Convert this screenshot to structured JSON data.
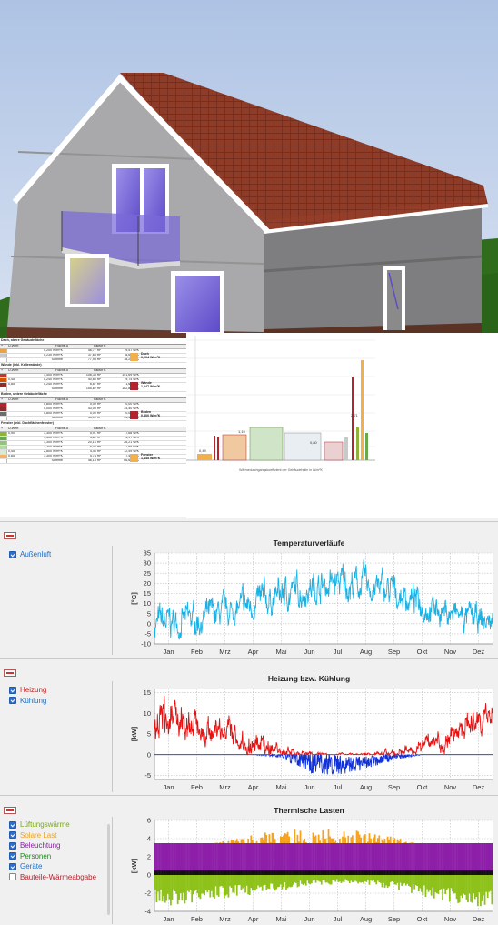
{
  "scene": {
    "colors": {
      "sky_top": "#b7c9e6",
      "sky_bottom": "#e9eef6",
      "grass": "#2d6b1c",
      "roof": "#8c3a28",
      "wall": "#a8a8a8",
      "wall_dark": "#7d7d7d",
      "glass": "#7e6fd6"
    }
  },
  "report": {
    "blocks": [
      {
        "title": "Dach, obere Gebäudefläche",
        "columns": [
          "+",
          "U-Wert",
          "Fläche A",
          "Faktor K"
        ],
        "rows": [
          {
            "color": "#e8a34a",
            "cells": [
              "",
              "0,200 W/m²K",
              "46,77 m²",
              "9,57 W/K"
            ]
          },
          {
            "color": "#c9c9c9",
            "cells": [
              "",
              "0,230 W/m²K",
              "37,68 m²",
              "8,64 W/K"
            ]
          },
          {
            "color": "#ffffff",
            "cells": [
              "",
              "Summe",
              "77,98 m²",
              "18,21 W/K"
            ]
          }
        ],
        "summary": {
          "label": "Dach",
          "value": "0,204 W/m²K",
          "color": "#f2b04b"
        }
      },
      {
        "title": "Wände (inkl. Kellerwände)",
        "columns": [
          "+",
          "U-Wert",
          "Fläche A",
          "Faktor K"
        ],
        "rows": [
          {
            "color": "#c0392b",
            "cells": [
              "",
              "1,400 W/m²K",
              "108,35 m²",
              "151,69 W/K"
            ]
          },
          {
            "color": "#d35400",
            "cells": [
              "0,45",
              "0,240 W/m²K",
              "40,60 m²",
              "9,74 W/K"
            ]
          },
          {
            "color": "#8e2b2b",
            "cells": [
              "0,85",
              "0,240 W/m²K",
              "6,67 m²",
              "1,60 W/K"
            ]
          },
          {
            "color": "#ffffff",
            "cells": [
              "",
              "Summe",
              "155,62 m²",
              "162,84 W/K"
            ]
          }
        ],
        "summary": {
          "label": "Wände",
          "value": "1,047 W/m²K",
          "color": "#b3242e"
        }
      },
      {
        "title": "Boden, untere Gebäudefläche",
        "columns": [
          "+",
          "U-Wert",
          "Fläche A",
          "Faktor K"
        ],
        "rows": [
          {
            "color": "#b3242e",
            "cells": [
              "",
              "0,800 W/m²K",
              "0,00 m²",
              "0,00 W/K"
            ]
          },
          {
            "color": "#8e2b2b",
            "cells": [
              "",
              "0,000 W/m²K",
              "43,00 m²",
              "34,40 W/K"
            ]
          },
          {
            "color": "#6d6d6d",
            "cells": [
              "",
              "0,800 W/m²K",
              "0,00 m²",
              "0,00 W/K"
            ]
          },
          {
            "color": "#ffffff",
            "cells": [
              "",
              "Summe",
              "43,00 m²",
              "34,40 W/K"
            ]
          }
        ],
        "summary": {
          "label": "Boden",
          "value": "0,800 W/m²K",
          "color": "#b3242e"
        }
      },
      {
        "title": "Fenster (inkl. Dachflächenfenster)",
        "columns": [
          "+",
          "U-Wert",
          "Fläche A",
          "Faktor K"
        ],
        "rows": [
          {
            "color": "#8fb33a",
            "cells": [
              "0,90",
              "1,300 W/m²K",
              "5,91 m²",
              "7,68 W/K"
            ]
          },
          {
            "color": "#6aa84f",
            "cells": [
              "",
              "1,300 W/m²K",
              "3,82 m²",
              "4,97 W/K"
            ]
          },
          {
            "color": "#93c47d",
            "cells": [
              "",
              "1,300 W/m²K",
              "20,16 m²",
              "26,21 W/K"
            ]
          },
          {
            "color": "#b6d7a8",
            "cells": [
              "",
              "1,300 W/m²K",
              "6,06 m²",
              "7,88 W/K"
            ]
          },
          {
            "color": "#d9ead3",
            "cells": [
              "0,45",
              "2,800 W/m²K",
              "4,46 m²",
              "12,49 W/K"
            ]
          },
          {
            "color": "#f6b26b",
            "cells": [
              "0,85",
              "1,300 W/m²K",
              "5,74 m²",
              "7,46 W/K"
            ]
          },
          {
            "color": "#ffffff",
            "cells": [
              "",
              "Summe",
              "46,15 m²",
              "66,69 W/K"
            ]
          }
        ],
        "summary": {
          "label": "Fenster",
          "value": "1,445 W/m²K",
          "color": "#f2b04b"
        }
      }
    ],
    "chart": {
      "caption": "Wärmedurchgangskoeffizient der Gebäudehülle in W/m²K",
      "value_labels": [
        "0,49",
        "1,15",
        "0,80",
        "2,71"
      ]
    }
  },
  "panels": [
    {
      "title": "Temperaturverläufe",
      "legend": [
        {
          "label": "Außenluft",
          "checked": true,
          "color": "#1d6fc5"
        }
      ]
    },
    {
      "title": "Heizung bzw. Kühlung",
      "legend": [
        {
          "label": "Heizung",
          "checked": true,
          "color": "#d01c1c"
        },
        {
          "label": "Kühlung",
          "checked": true,
          "color": "#1d6fc5"
        }
      ]
    },
    {
      "title": "Thermische Lasten",
      "legend": [
        {
          "label": "Lüftungswärme",
          "checked": true,
          "color": "#7aa61c"
        },
        {
          "label": "Solare Last",
          "checked": true,
          "color": "#f0a31c"
        },
        {
          "label": "Beleuchtung",
          "checked": true,
          "color": "#8a1fa0"
        },
        {
          "label": "Personen",
          "checked": true,
          "color": "#1f8a1f"
        },
        {
          "label": "Geräte",
          "checked": true,
          "color": "#1d6fc5"
        },
        {
          "label": "Bauteile-Wärmeabgabe",
          "checked": false,
          "color": "#b3242e"
        }
      ]
    }
  ],
  "chart_data": [
    {
      "type": "line",
      "title": "Temperaturverläufe",
      "ylabel": "[°C]",
      "ylim": [
        -10,
        35
      ],
      "yticks": [
        -10,
        -5,
        0,
        5,
        10,
        15,
        20,
        25,
        30,
        35
      ],
      "x_tick_labels": [
        "Jan",
        "Feb",
        "Mrz",
        "Apr",
        "Mai",
        "Jun",
        "Jul",
        "Aug",
        "Sep",
        "Okt",
        "Nov",
        "Dez"
      ],
      "grid": true,
      "series": [
        {
          "name": "Außenluft",
          "color": "#19b2e6",
          "monthly_min": [
            -9,
            -6,
            -2,
            2,
            5,
            9,
            11,
            10,
            6,
            1,
            -3,
            -8
          ],
          "monthly_mean": [
            0,
            2,
            5,
            9,
            14,
            18,
            20,
            19,
            15,
            10,
            5,
            1
          ],
          "monthly_max": [
            12,
            14,
            17,
            23,
            27,
            31,
            34,
            32,
            27,
            20,
            15,
            12
          ]
        }
      ]
    },
    {
      "type": "line",
      "title": "Heizung bzw. Kühlung",
      "ylabel": "[kW]",
      "ylim": [
        -6,
        16
      ],
      "yticks": [
        -5,
        0,
        5,
        10,
        15
      ],
      "x_tick_labels": [
        "Jan",
        "Feb",
        "Mrz",
        "Apr",
        "Mai",
        "Jun",
        "Jul",
        "Aug",
        "Sep",
        "Okt",
        "Nov",
        "Dez"
      ],
      "grid": true,
      "series": [
        {
          "name": "Heizung",
          "color": "#e81010",
          "monthly_mean": [
            8,
            7,
            5,
            2.5,
            1,
            0.2,
            0,
            0,
            0.5,
            2,
            5,
            8
          ],
          "monthly_max": [
            16,
            12,
            10,
            7,
            3,
            1,
            0.5,
            0.5,
            2,
            5,
            10,
            13
          ]
        },
        {
          "name": "Kühlung",
          "color": "#1030d8",
          "monthly_mean": [
            0,
            0,
            0,
            0,
            0,
            -1.5,
            -2.5,
            -2,
            -0.5,
            0,
            0,
            0
          ],
          "monthly_min": [
            0,
            0,
            0,
            0,
            -1,
            -5.5,
            -5.5,
            -4,
            -1.5,
            0,
            0,
            0
          ]
        }
      ]
    },
    {
      "type": "bar",
      "title": "Thermische Lasten",
      "ylabel": "[kW]",
      "ylim": [
        -4,
        6
      ],
      "yticks": [
        -4,
        -2,
        0,
        2,
        4,
        6
      ],
      "x_tick_labels": [
        "Jan",
        "Feb",
        "Mrz",
        "Apr",
        "Mai",
        "Jun",
        "Jul",
        "Aug",
        "Sep",
        "Okt",
        "Nov",
        "Dez"
      ],
      "grid": true,
      "series": [
        {
          "name": "Lüftungswärme",
          "color": "#8ec21a",
          "monthly_min": [
            -3.5,
            -3.0,
            -2.6,
            -2.2,
            -1.8,
            -1.2,
            -1.0,
            -1.0,
            -1.6,
            -2.4,
            -3.0,
            -3.6
          ]
        },
        {
          "name": "Solare Last",
          "color": "#f5a21c",
          "monthly_max": [
            2.2,
            3.0,
            3.8,
            4.5,
            5.0,
            5.2,
            5.1,
            4.8,
            4.2,
            3.3,
            2.4,
            2.0
          ]
        },
        {
          "name": "Beleuchtung",
          "color": "#8d1fa8",
          "value": 3.5
        },
        {
          "name": "Personen",
          "color": "#1f8a1f",
          "value": 0.5
        },
        {
          "name": "Geräte",
          "color": "#1d6fc5",
          "value": 0.3
        }
      ]
    }
  ]
}
